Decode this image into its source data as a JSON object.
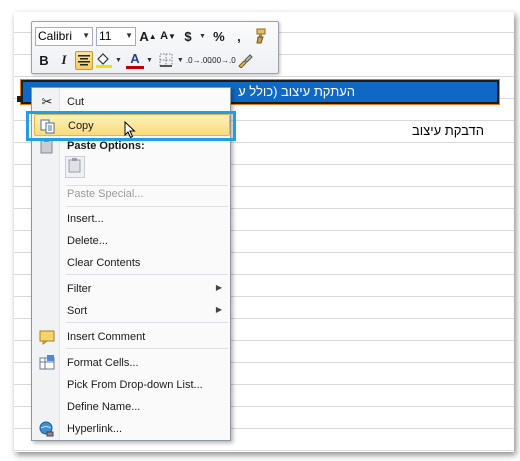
{
  "mini_toolbar": {
    "font_name": "Calibri",
    "font_size": "11",
    "grow_font": "A",
    "shrink_font": "A",
    "currency": "$",
    "percent": "%",
    "comma": ",",
    "bold": "B",
    "italic": "I",
    "font_color": "A",
    "increase_decimal": ".0→.00",
    "decrease_decimal": ".00→.0"
  },
  "cells": {
    "selected_text": "העתקת עיצוב (כולל ע",
    "below_text": "הדבקת עיצוב"
  },
  "context_menu": {
    "items": [
      {
        "label": "Cut",
        "icon": "scissors-icon"
      },
      {
        "label": "Copy",
        "icon": "copy-icon"
      },
      {
        "label": "Paste Options:",
        "icon": "clipboard-icon"
      },
      {
        "label": "Paste Special...",
        "icon": ""
      },
      {
        "label": "Insert...",
        "icon": ""
      },
      {
        "label": "Delete...",
        "icon": ""
      },
      {
        "label": "Clear Contents",
        "icon": ""
      },
      {
        "label": "Filter",
        "icon": ""
      },
      {
        "label": "Sort",
        "icon": ""
      },
      {
        "label": "Insert Comment",
        "icon": "comment-icon"
      },
      {
        "label": "Format Cells...",
        "icon": "format-cells-icon"
      },
      {
        "label": "Pick From Drop-down List...",
        "icon": ""
      },
      {
        "label": "Define Name...",
        "icon": ""
      },
      {
        "label": "Hyperlink...",
        "icon": "hyperlink-icon"
      }
    ]
  },
  "colors": {
    "selection": "#0f69c4",
    "menu_hover": "#f9dc79",
    "annotation_box": "#1fa1df"
  }
}
